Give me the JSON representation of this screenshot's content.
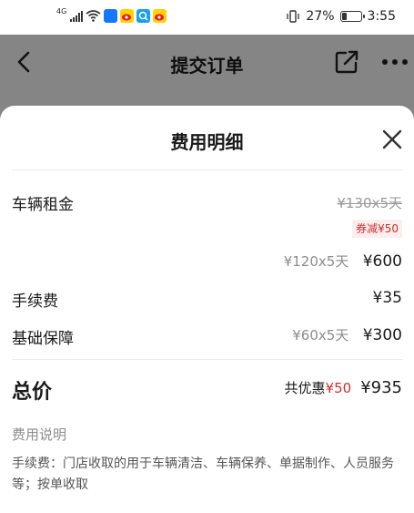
{
  "status_bar": {
    "network": "4G",
    "battery": "27%",
    "battery_level": 0.27,
    "time": "3:55",
    "apps": [
      "alipay-app-icon",
      "weibo-app-icon",
      "search-app-icon",
      "weibo-app-icon"
    ]
  },
  "header": {
    "title": "提交订单"
  },
  "sheet": {
    "title": "费用明细",
    "rent": {
      "label": "车辆租金",
      "original": "¥130x5天",
      "coupon": "券减¥50",
      "unit": "¥120x5天",
      "amount": "¥600"
    },
    "fee": {
      "label": "手续费",
      "amount": "¥35"
    },
    "insurance": {
      "label": "基础保障",
      "unit": "¥60x5天",
      "amount": "¥300"
    },
    "total": {
      "label": "总价",
      "saving_label": "共优惠",
      "saving_amount": "¥50",
      "amount": "¥935"
    },
    "note": {
      "title": "费用说明",
      "text": "手续费：门店收取的用于车辆清洁、车辆保养、单据制作、人员服务等；按单收取"
    }
  },
  "colors": {
    "accent_red": "#c9302c",
    "overlay": "rgba(0,0,0,0.48)"
  }
}
